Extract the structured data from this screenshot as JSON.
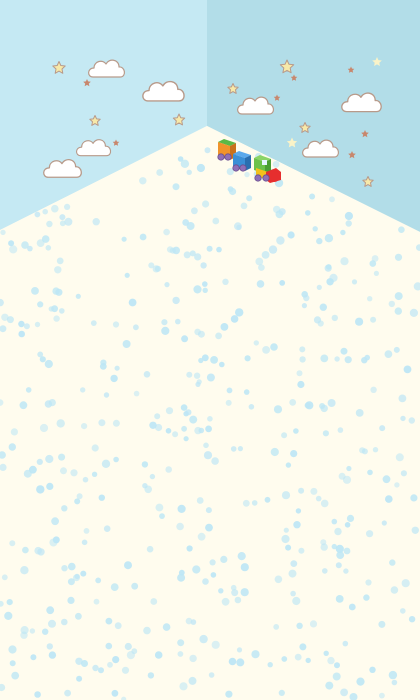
{
  "scene": {
    "type": "toy-room-corner",
    "colors": {
      "left_wall": "#c5e9f3",
      "right_wall": "#b2dde8",
      "floor": "#fffcee",
      "floor_dot": "#bde6f5",
      "star_yellow": "#f7e9a9",
      "star_pale": "#faf3c8",
      "star_brown": "#c8876d",
      "cloud_fill": "#ffffff",
      "cloud_outline": "#b89a8a"
    },
    "wall_decor": {
      "clouds": 8,
      "stars": 16
    },
    "toy": {
      "name": "toy-train",
      "cars": [
        {
          "role": "wagon",
          "color": "#f0932b",
          "top": "#5bb846"
        },
        {
          "role": "wagon",
          "color": "#3a8fd6",
          "top": "#2a6fb0"
        },
        {
          "role": "locomotive",
          "color": "#e62e2e",
          "cab": "#6cc24a",
          "trim": "#f3c11c"
        }
      ],
      "wheel_color": "#8e6fb7"
    }
  }
}
